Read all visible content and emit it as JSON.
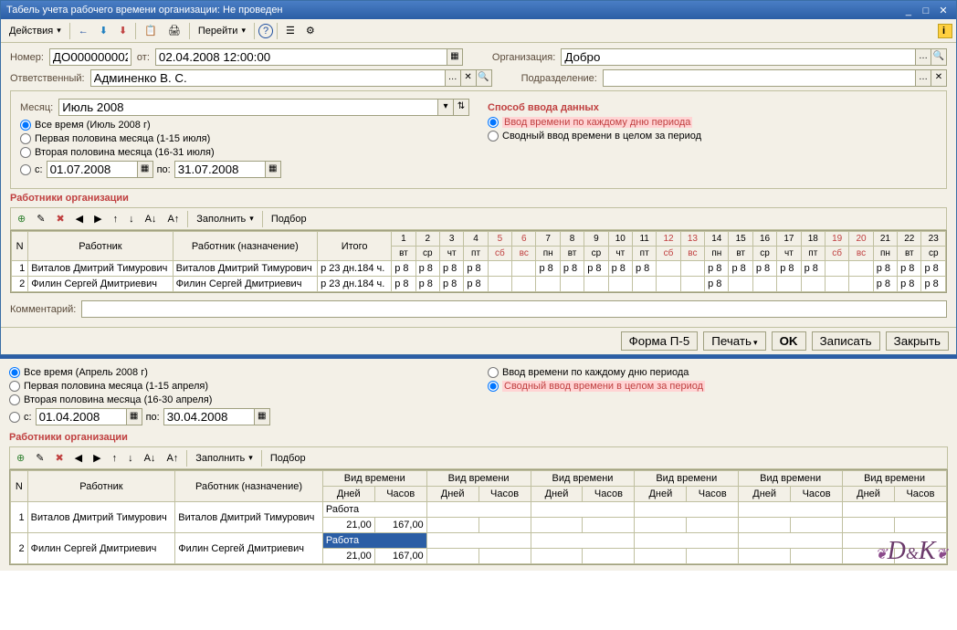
{
  "titlebar": {
    "title": "Табель учета рабочего времени организации: Не проведен"
  },
  "toolbar": {
    "actions": "Действия",
    "goto": "Перейти"
  },
  "header": {
    "number_lbl": "Номер:",
    "number_val": "ДО000000002",
    "from_lbl": "от:",
    "from_val": "02.04.2008 12:00:00",
    "org_lbl": "Организация:",
    "org_val": "Добро",
    "resp_lbl": "Ответственный:",
    "resp_val": "Админенко В. С.",
    "dept_lbl": "Подразделение:"
  },
  "month_panel": {
    "month_lbl": "Месяц:",
    "month_val": "Июль 2008",
    "r1": "Все время (Июль 2008 г)",
    "r2": "Первая половина месяца (1-15 июля)",
    "r3": "Вторая половина месяца (16-31 июля)",
    "r4": "с:",
    "date1": "01.07.2008",
    "to": "по:",
    "date2": "31.07.2008",
    "input_title": "Способ ввода данных",
    "ir1": "Ввод времени по каждому дню периода",
    "ir2": "Сводный ввод времени в целом за период"
  },
  "workers": {
    "title": "Работники организации",
    "fill": "Заполнить",
    "pick": "Подбор",
    "cols": {
      "n": "N",
      "worker": "Работник",
      "worker2": "Работник (назначение)",
      "total": "Итого"
    },
    "days": [
      {
        "n": "1",
        "d": "вт"
      },
      {
        "n": "2",
        "d": "ср"
      },
      {
        "n": "3",
        "d": "чт"
      },
      {
        "n": "4",
        "d": "пт"
      },
      {
        "n": "5",
        "d": "сб",
        "w": 1
      },
      {
        "n": "6",
        "d": "вс",
        "w": 1
      },
      {
        "n": "7",
        "d": "пн"
      },
      {
        "n": "8",
        "d": "вт"
      },
      {
        "n": "9",
        "d": "ср"
      },
      {
        "n": "10",
        "d": "чт"
      },
      {
        "n": "11",
        "d": "пт"
      },
      {
        "n": "12",
        "d": "сб",
        "w": 1
      },
      {
        "n": "13",
        "d": "вс",
        "w": 1
      },
      {
        "n": "14",
        "d": "пн"
      },
      {
        "n": "15",
        "d": "вт"
      },
      {
        "n": "16",
        "d": "ср"
      },
      {
        "n": "17",
        "d": "чт"
      },
      {
        "n": "18",
        "d": "пт"
      },
      {
        "n": "19",
        "d": "сб",
        "w": 1
      },
      {
        "n": "20",
        "d": "вс",
        "w": 1
      },
      {
        "n": "21",
        "d": "пн"
      },
      {
        "n": "22",
        "d": "вт"
      },
      {
        "n": "23",
        "d": "ср"
      }
    ],
    "rows": [
      {
        "n": "1",
        "name": "Виталов Дмитрий Тимурович",
        "total": "р 23 дн.184 ч.",
        "cells": [
          "р 8",
          "р 8",
          "р 8",
          "р 8",
          "",
          "",
          "р 8",
          "р 8",
          "р 8",
          "р 8",
          "р 8",
          "",
          "",
          "р 8",
          "р 8",
          "р 8",
          "р 8",
          "р 8",
          "",
          "",
          "р 8",
          "р 8",
          "р 8"
        ]
      },
      {
        "n": "2",
        "name": "Филин Сергей Дмитриевич",
        "total": "р 23 дн.184 ч.",
        "cells": [
          "р 8",
          "р 8",
          "р 8",
          "р 8",
          "",
          "",
          "",
          "",
          "",
          "",
          "",
          "",
          "",
          "р 8",
          "",
          "",
          "",
          "",
          "",
          "",
          "р 8",
          "р 8",
          "р 8"
        ]
      }
    ],
    "comment_lbl": "Комментарий:"
  },
  "footer": {
    "b1": "Форма П-5",
    "b2": "Печать",
    "b3": "OK",
    "b4": "Записать",
    "b5": "Закрыть"
  },
  "lower": {
    "r1": "Все время (Апрель 2008 г)",
    "r2": "Первая половина месяца (1-15 апреля)",
    "r3": "Вторая половина месяца (16-30 апреля)",
    "r4": "с:",
    "date1": "01.04.2008",
    "to": "по:",
    "date2": "30.04.2008",
    "ir1": "Ввод времени по каждому дню периода",
    "ir2": "Сводный ввод времени в целом за период",
    "workers_title": "Работники организации",
    "fill": "Заполнить",
    "pick": "Подбор",
    "cols": {
      "n": "N",
      "worker": "Работник",
      "worker2": "Работник (назначение)",
      "timetype": "Вид времени",
      "days": "Дней",
      "hours": "Часов"
    },
    "rows": [
      {
        "n": "1",
        "name": "Виталов Дмитрий Тимурович",
        "tt": "Работа",
        "d": "21,00",
        "h": "167,00"
      },
      {
        "n": "2",
        "name": "Филин Сергей Дмитриевич",
        "tt": "Работа",
        "d": "21,00",
        "h": "167,00",
        "sel": 1
      }
    ]
  }
}
